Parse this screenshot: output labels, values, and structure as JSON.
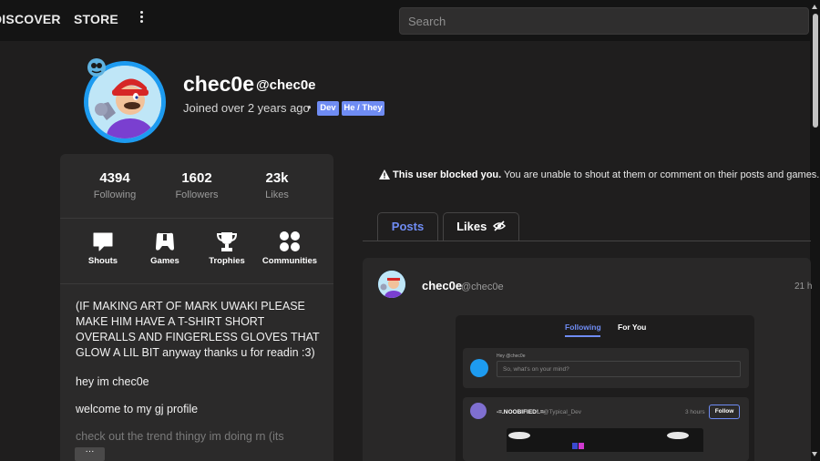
{
  "topbar": {
    "nav": [
      "DISCOVER",
      "STORE"
    ],
    "search_placeholder": "Search"
  },
  "profile": {
    "display_name": "chec0e",
    "handle": "@chec0e",
    "joined": "Joined over 2 years ago",
    "separator": "•",
    "tags": [
      "Dev",
      "He / They"
    ]
  },
  "stats": [
    {
      "value": "4394",
      "label": "Following"
    },
    {
      "value": "1602",
      "label": "Followers"
    },
    {
      "value": "23k",
      "label": "Likes"
    }
  ],
  "menu": [
    {
      "label": "Shouts",
      "icon": "shout-bubble-icon"
    },
    {
      "label": "Games",
      "icon": "gamepad-icon"
    },
    {
      "label": "Trophies",
      "icon": "trophy-icon"
    },
    {
      "label": "Communities",
      "icon": "communities-icon"
    }
  ],
  "bio": [
    "(IF MAKING ART OF MARK UWAKI PLEASE MAKE HIM HAVE A T-SHIRT SHORT OVERALLS AND FINGERLESS GLOVES THAT GLOW A LIL BIT anyway thanks u for readin :3)",
    "hey im chec0e",
    "welcome to my gj profile",
    "check out the trend thingy im doing rn (its"
  ],
  "more_label": "···",
  "blocked": {
    "bold": "This user blocked you.",
    "rest": " You are unable to shout at them or comment on their posts and games."
  },
  "tabs": [
    {
      "label": "Posts",
      "active": true
    },
    {
      "label": "Likes",
      "icon": "hidden-eye-icon",
      "active": false
    }
  ],
  "post": {
    "name": "chec0e",
    "handle": "@chec0e",
    "time": "21 h"
  },
  "embedded": {
    "tabs": [
      "Following",
      "For You"
    ],
    "compose_hey": "Hey @chec0e",
    "compose_placeholder": "So, what's on your mind?",
    "post_name": "-=.NOOBIFIED!.=-",
    "post_handle": "@Typical_Dev",
    "post_time": "3 hours",
    "follow_label": "Follow"
  },
  "colors": {
    "background": "#1f1e1e",
    "topbar": "#141414",
    "card": "#2b2a2a",
    "accent": "#6f8cf3",
    "avatar_ring": "#1d9bf0"
  }
}
